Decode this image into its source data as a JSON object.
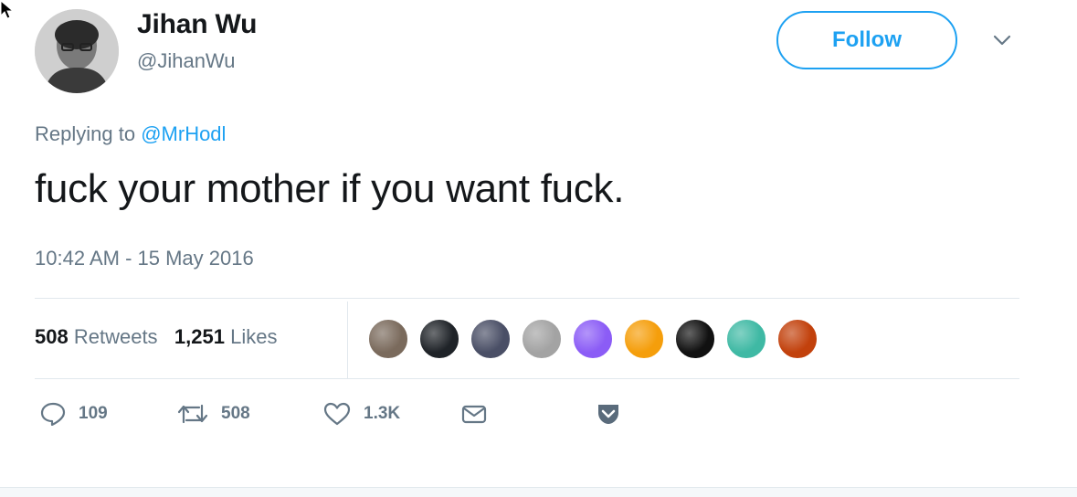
{
  "tweet": {
    "author_name": "Jihan Wu",
    "author_handle": "@JihanWu",
    "follow_label": "Follow",
    "reply_prefix": "Replying to",
    "reply_handle": "@MrHodl",
    "text": "fuck your mother if you want fuck.",
    "timestamp": "10:42 AM - 15 May 2016"
  },
  "stats": {
    "retweets_count": "508",
    "retweets_label": "Retweets",
    "likes_count": "1,251",
    "likes_label": "Likes"
  },
  "likers": [
    {
      "color": "#7a6a5c"
    },
    {
      "color": "#1f2328"
    },
    {
      "color": "#4a4f66"
    },
    {
      "color": "#a3a3a3"
    },
    {
      "color": "#8b5cf6"
    },
    {
      "color": "#f59e0b"
    },
    {
      "color": "#111111"
    },
    {
      "color": "#3fb9a4"
    },
    {
      "color": "#c2410c"
    }
  ],
  "actions": {
    "reply_count": "109",
    "retweet_count": "508",
    "like_count": "1.3K"
  },
  "colors": {
    "accent": "#1da1f2",
    "muted": "#657786",
    "text": "#14171a",
    "pocket": "#5a6b7b"
  },
  "icons": {
    "reply": "reply-icon",
    "retweet": "retweet-icon",
    "like": "heart-icon",
    "dm": "envelope-icon",
    "pocket": "pocket-icon",
    "caret": "chevron-down-icon"
  }
}
